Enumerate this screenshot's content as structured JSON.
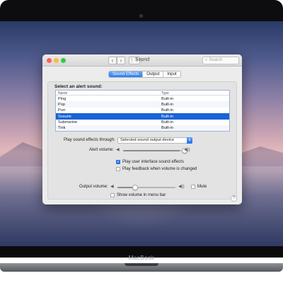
{
  "device": {
    "brand": "MacBook"
  },
  "window": {
    "title": "Sound",
    "search_placeholder": "Search",
    "nav_back": "‹",
    "nav_forward": "›",
    "grid": "⋮⋮⋮"
  },
  "tabs": [
    {
      "label": "Sound Effects",
      "active": true
    },
    {
      "label": "Output",
      "active": false
    },
    {
      "label": "Input",
      "active": false
    }
  ],
  "alert": {
    "section_label": "Select an alert sound:",
    "columns": {
      "name": "Name",
      "type": "Type"
    },
    "rows": [
      {
        "name": "Ping",
        "type": "Built-in"
      },
      {
        "name": "Pop",
        "type": "Built-in"
      },
      {
        "name": "Purr",
        "type": "Built-in"
      },
      {
        "name": "Sosumi",
        "type": "Built-in",
        "selected": true
      },
      {
        "name": "Submarine",
        "type": "Built-in"
      },
      {
        "name": "Tink",
        "type": "Built-in"
      }
    ]
  },
  "settings": {
    "play_through_label": "Play sound effects through:",
    "play_through_value": "Selected sound output device",
    "alert_volume_label": "Alert volume:",
    "alert_volume_level": 0.98,
    "ui_effects_label": "Play user interface sound effects",
    "ui_effects_checked": true,
    "feedback_label": "Play feedback when volume is changed",
    "feedback_checked": false,
    "help": "?"
  },
  "footer": {
    "output_volume_label": "Output volume:",
    "output_volume_level": 0.3,
    "mute_label": "Mute",
    "mute_checked": false,
    "menu_bar_label": "Show volume in menu bar",
    "menu_bar_checked": false
  },
  "colors": {
    "accent": "#2d7ef0",
    "selection": "#1b63d6",
    "traffic_red": "#fc605c",
    "traffic_yellow": "#fdbc40",
    "traffic_green": "#34c84a"
  }
}
